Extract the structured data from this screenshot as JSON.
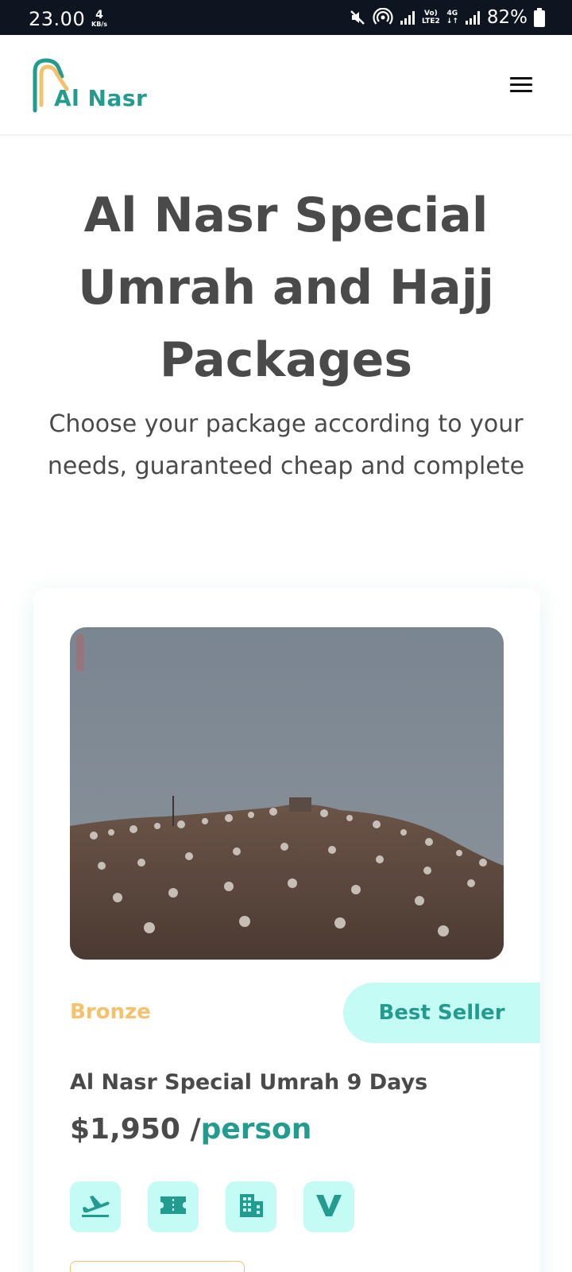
{
  "status_bar": {
    "time": "23.00",
    "speed_value": "4",
    "speed_unit": "KB/s",
    "network_label_top": "Vo)",
    "network_label_bottom": "LTE2",
    "network_type": "4G",
    "battery_percent": "82%"
  },
  "header": {
    "logo_text": "Al Nasr",
    "logo_colors": {
      "teal": "#239b8f",
      "gold": "#f5c16c"
    },
    "menu_icon": "hamburger-menu-icon"
  },
  "hero": {
    "title": "Al Nasr Special Umrah and Hajj Packages",
    "subtitle": "Choose your package according to your needs, guaranteed cheap and complete"
  },
  "package": {
    "image_icon": "pilgrims-on-mountain-photo",
    "tier": "Bronze",
    "badge": "Best Seller",
    "name": "Al Nasr Special Umrah 9 Days",
    "price": "$1,950 /",
    "price_unit": "person",
    "features": [
      {
        "icon": "airplane-departure-icon"
      },
      {
        "icon": "ticket-icon"
      },
      {
        "icon": "hotel-building-icon"
      },
      {
        "icon": "visa-v-icon"
      }
    ]
  },
  "colors": {
    "primary_teal": "#239b8f",
    "accent_gold": "#f5c16c",
    "badge_bg": "#c4fbf5",
    "text_dark": "#4a4a4a"
  }
}
